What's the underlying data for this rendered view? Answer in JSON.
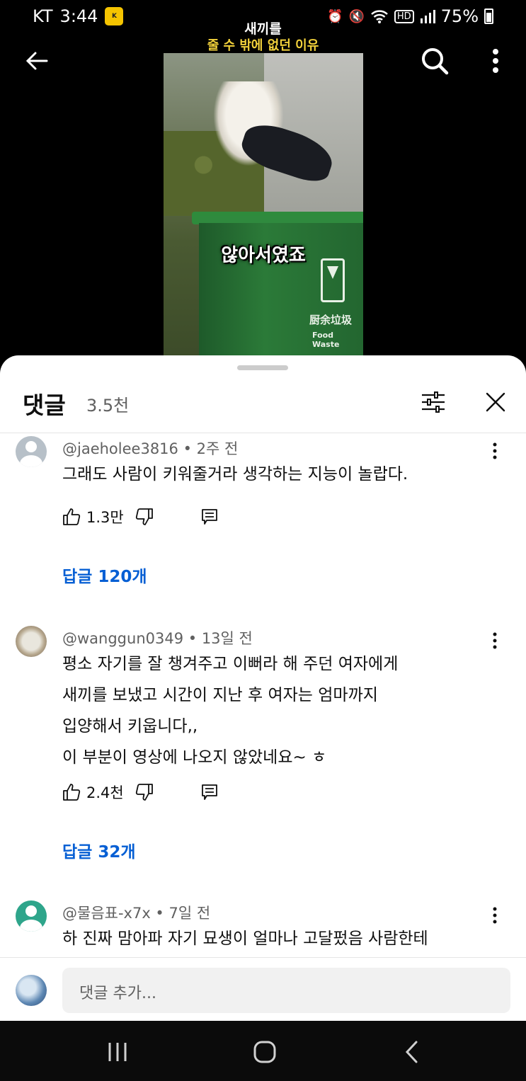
{
  "status_bar": {
    "carrier": "KT",
    "time": "3:44",
    "battery": "75%"
  },
  "video": {
    "title_line1": "새끼를",
    "title_line2": "줄 수 밖에 없던 이유",
    "caption": "않아서였죠",
    "bin_text_cn": "厨余垃圾",
    "bin_text_en": "Food Waste"
  },
  "comments_panel": {
    "title": "댓글",
    "count": "3.5천",
    "comments": [
      {
        "meta": "@jaeholee3816 • 2주 전",
        "text": "그래도 사람이 키워줄거라 생각하는 지능이 놀랍다.",
        "likes": "1.3만",
        "replies": "답글 120개"
      },
      {
        "meta": "@wanggun0349 • 13일 전",
        "text": "평소 자기를 잘 챙겨주고 이뻐라 해 주던 여자에게\n새끼를 보냈고 시간이 지난 후 여자는 엄마까지\n입양해서 키웁니다,,\n이 부분이 영상에 나오지 않았네요~ ㅎ",
        "likes": "2.4천",
        "replies": "답글 32개"
      },
      {
        "meta": "@물음표-x7x • 7일 전",
        "text": "하 진짜 맘아파 자기 묘생이 얼마나 고달펐음 사람한테"
      }
    ],
    "composer_placeholder": "댓글 추가..."
  },
  "icons": {
    "back": "back-arrow-icon",
    "search": "search-icon",
    "more": "more-vert-icon",
    "filter": "filter-sliders-icon",
    "close": "close-icon",
    "like": "thumb-up-icon",
    "dislike": "thumb-down-icon",
    "reply": "reply-comment-icon",
    "nav_recents": "recents-icon",
    "nav_home": "home-icon",
    "nav_back": "nav-back-icon"
  },
  "colors": {
    "link": "#065fd4",
    "panel_bg": "#ffffff",
    "secondary_text": "#606060",
    "video_subtitle": "#f2d13b"
  }
}
